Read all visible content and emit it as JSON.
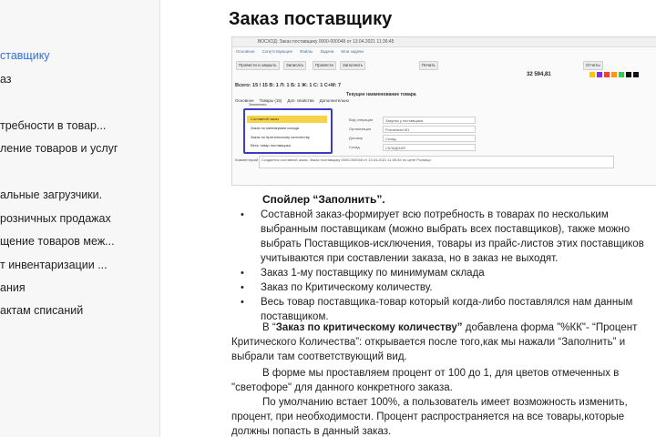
{
  "sidebar": {
    "items": [
      {
        "label": "ставщику",
        "active": true
      },
      {
        "label": "аз",
        "active": false
      },
      {
        "label": "требности в товар...",
        "active": false
      },
      {
        "label": "ление товаров и услуг",
        "active": false
      },
      {
        "label": "альные загрузчики.",
        "active": false
      },
      {
        "label": "розничных продажах",
        "active": false
      },
      {
        "label": "щение товаров меж...",
        "active": false
      },
      {
        "label": "т инвентаризации ...",
        "active": false
      },
      {
        "label": "ания",
        "active": false
      },
      {
        "label": "актам списаний",
        "active": false
      }
    ],
    "active_color": "#2f6fdd"
  },
  "main": {
    "title": "Заказ поставщику",
    "screenshot": {
      "window_title": "ВОСХОД: Заказ поставщику 0000-000048 от 13.04.2021 11:36:45",
      "top_tabs": [
        "Основное",
        "Сопутствующее",
        "Файлы",
        "Задачи",
        "Мои задачи"
      ],
      "toolbar_buttons": [
        "Провести и закрыть",
        "Записать",
        "Провести",
        "Заполнить",
        "Печать",
        "Отчеты"
      ],
      "sum": "32 594,81",
      "swatch_colors": [
        "#f7c600",
        "#8a2be2",
        "#ff3b30",
        "#ff9500",
        "#34c759",
        "#111111",
        "#111111"
      ],
      "stats": "Всего: 15 / 15  В: 1  Л: 1  Б: 1  Ж: 1  С: 1  С+М: 7",
      "subheading": "Текущее наименование товара",
      "detail_tabs": [
        "Основное",
        "Товары (15)",
        "Доп. свойства",
        "Дополнительно"
      ],
      "menu_header": "Заполнить",
      "menu_items": [
        "Составной заказ",
        "Заказ по минимумам склада",
        "Заказ по Критическому количеству",
        "Весь товар поставщика"
      ],
      "field_labels": [
        "Вид операции",
        "Организация",
        "Договор",
        "Склад"
      ],
      "field_values": [
        "Закупка у поставщика",
        "Розничная М1",
        "Склад",
        "СКЛАДНАЯ"
      ],
      "comment_label": "Комментарий",
      "comment_text": "Создается составной заказ. Заказ поставщику 0000-000048 от 13.04.2021 11:35:45 по цене Розница"
    },
    "spoiler_title": "Спойлер  “Заполнить”.",
    "bullets": [
      " Составной заказ-формирует всю потребность в товарах по нескольким выбранным поставщикам (можно выбрать всех поставщиков), также можно выбрать Поставщиков-исключения, товары из прайс-листов этих поставщиков учитываются при составлении заказа, но в заказ не выходят.",
      "Заказ 1-му поставщику по минимумам склада",
      "Заказ по Критическому количеству.",
      "Весь товар поставщика-товар который когда-либо поставлялся нам данным поставщиком."
    ],
    "para1_bold": "Заказ по критическому количеству”",
    "para1_prefix": "В “",
    "para1_rest": " добавлена  форма \"%КК\"- “Процент Критического Количества”: открывается после того,как мы нажали “Заполнить” и выбрали там соответствующий вид.",
    "para2": "В форме мы проставляем процент от 100 до 1, для цветов отмеченных в \"светофоре\" для данного конкретного заказа.",
    "para3": "По умолчанию встает 100%, а пользователь  имеет возможность изменить, процент, при необходимости. Процент распространяется на все товары,которые должны попасть в данный заказ."
  }
}
